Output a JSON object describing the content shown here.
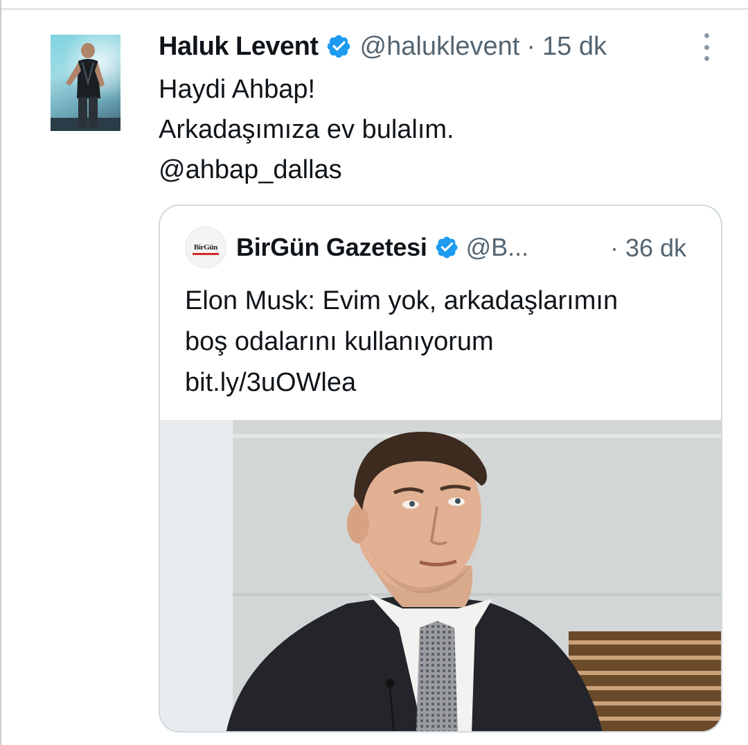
{
  "tweet": {
    "display_name": "Haluk Levent",
    "handle": "@haluklevent",
    "separator": "·",
    "time": "15 dk",
    "verified_icon": "verified-badge-icon",
    "more_icon": "more-vertical-icon",
    "lines": [
      "Haydi Ahbap!",
      "Arkadaşımıza ev bulalım.",
      "@ahbap_dallas"
    ]
  },
  "quote": {
    "avatar_text": "BirGün",
    "display_name": "BirGün Gazetesi",
    "handle": "@B...",
    "time": "· 36 dk",
    "lines": [
      "Elon Musk: Evim yok, arkadaşlarımın",
      "boş odalarını kullanıyorum",
      "bit.ly/3uOWlea"
    ]
  },
  "colors": {
    "text_primary": "#0f1419",
    "text_secondary": "#536471",
    "verified_blue": "#1d9bf0",
    "card_border": "#cfd9de"
  }
}
